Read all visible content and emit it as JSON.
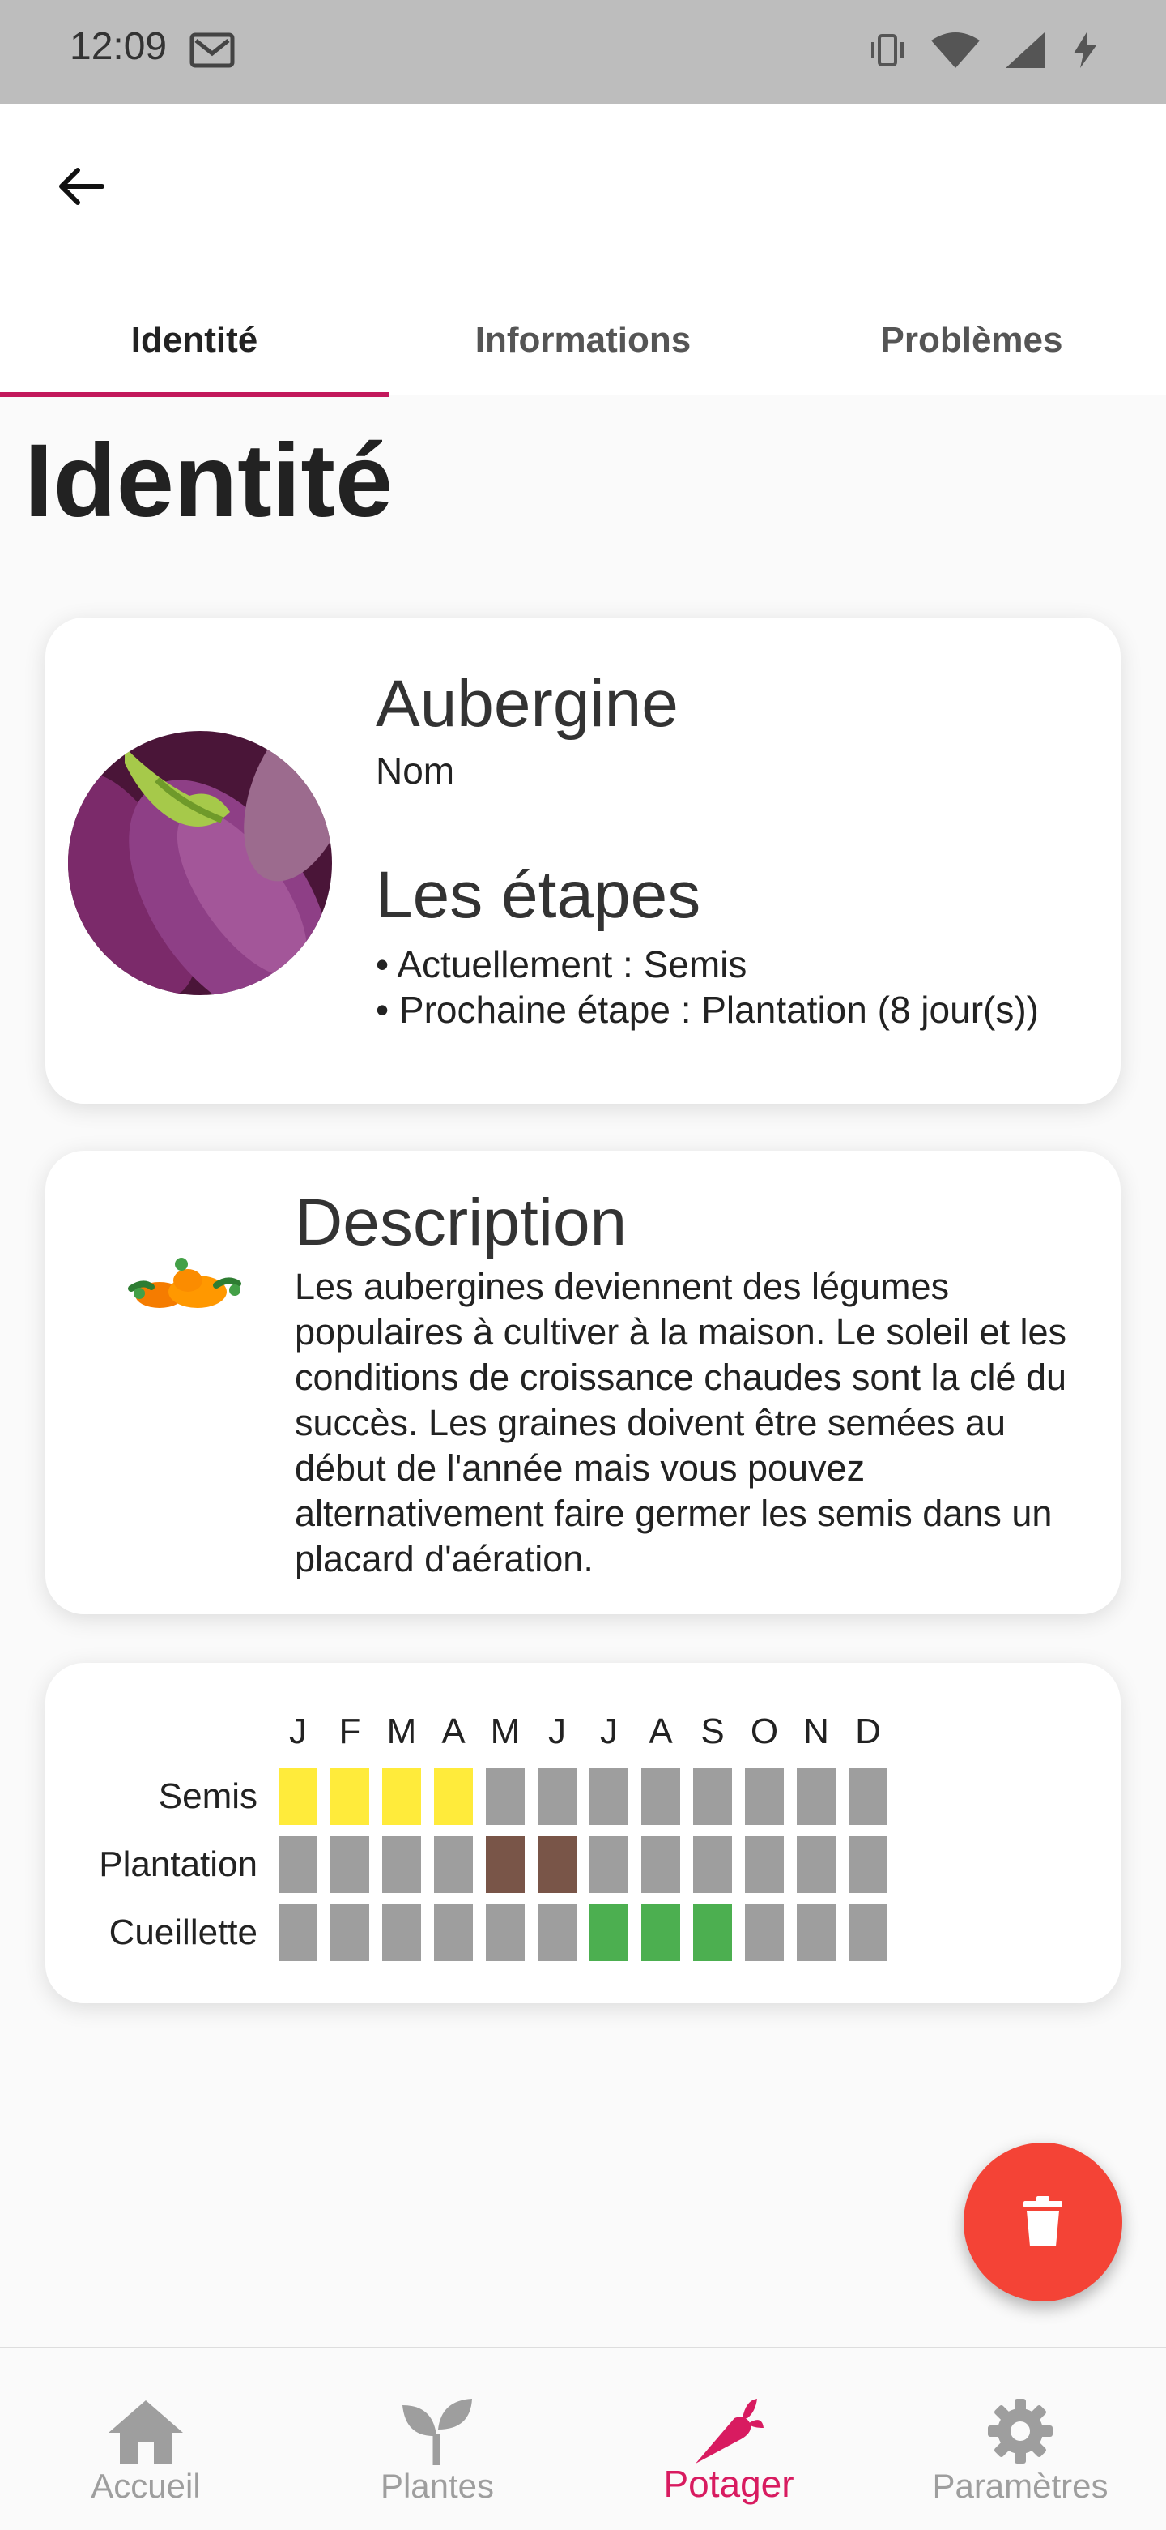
{
  "status_bar": {
    "time": "12:09"
  },
  "tabs": [
    {
      "label": "Identité",
      "active": true
    },
    {
      "label": "Informations",
      "active": false
    },
    {
      "label": "Problèmes",
      "active": false
    }
  ],
  "page_title": "Identité",
  "identity": {
    "name": "Aubergine",
    "name_caption": "Nom",
    "steps_title": "Les étapes",
    "current_step": "• Actuellement : Semis",
    "next_step": "• Prochaine étape : Plantation (8 jour(s))"
  },
  "description": {
    "title": "Description",
    "text": "Les aubergines deviennent des légumes populaires à cultiver à la maison. Le soleil et les conditions de croissance chaudes sont la clé du succès. Les graines doivent être semées au début de l'année mais vous pouvez alternativement faire germer les semis dans un placard d'aération."
  },
  "calendar": {
    "months": [
      "J",
      "F",
      "M",
      "A",
      "M",
      "J",
      "J",
      "A",
      "S",
      "O",
      "N",
      "D"
    ],
    "rows": [
      {
        "label": "Semis",
        "active_months": [
          1,
          2,
          3,
          4
        ],
        "color": "#ffeb3b"
      },
      {
        "label": "Plantation",
        "active_months": [
          5,
          6
        ],
        "color": "#795548"
      },
      {
        "label": "Cueillette",
        "active_months": [
          7,
          8,
          9
        ],
        "color": "#4caf50"
      }
    ],
    "inactive_color": "#9e9e9e"
  },
  "fab": {
    "icon": "trash-icon"
  },
  "bottom_nav": [
    {
      "label": "Accueil",
      "icon": "home-icon",
      "active": false
    },
    {
      "label": "Plantes",
      "icon": "sprout-icon",
      "active": false
    },
    {
      "label": "Potager",
      "icon": "carrot-icon",
      "active": true
    },
    {
      "label": "Paramètres",
      "icon": "gear-icon",
      "active": false
    }
  ],
  "colors": {
    "accent": "#d81b60",
    "tab_indicator": "#c2185b",
    "fab": "#f44336"
  }
}
